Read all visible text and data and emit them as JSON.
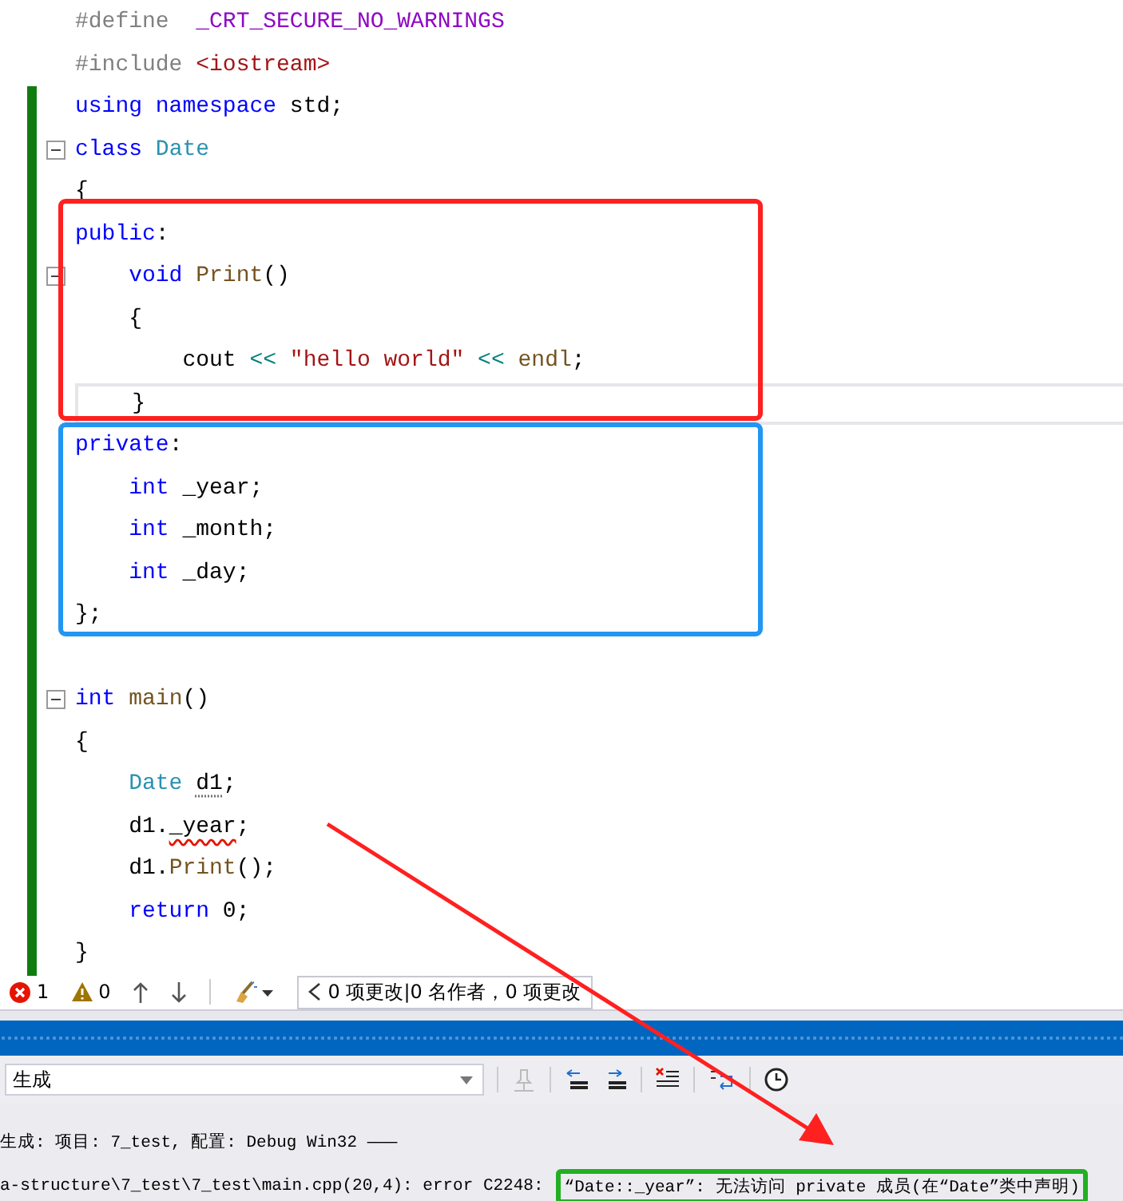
{
  "editor": {
    "lines": [
      {
        "changed": false,
        "current": false,
        "foldable": false,
        "tokens": [
          {
            "kind": "preproc",
            "text": "#define  "
          },
          {
            "kind": "macro",
            "text": "_CRT_SECURE_NO_WARNINGS"
          }
        ]
      },
      {
        "changed": false,
        "current": false,
        "foldable": false,
        "tokens": [
          {
            "kind": "preproc",
            "text": "#include "
          },
          {
            "kind": "string",
            "text": "<iostream>"
          }
        ]
      },
      {
        "changed": true,
        "current": false,
        "foldable": false,
        "tokens": [
          {
            "kind": "keyword",
            "text": "using namespace"
          },
          {
            "kind": "plain",
            "text": " std;"
          }
        ]
      },
      {
        "changed": true,
        "current": false,
        "foldable": true,
        "tokens": [
          {
            "kind": "keyword",
            "text": "class"
          },
          {
            "kind": "type",
            "text": " Date"
          }
        ]
      },
      {
        "changed": true,
        "current": false,
        "foldable": false,
        "tokens": [
          {
            "kind": "plain",
            "text": "{"
          }
        ]
      },
      {
        "changed": true,
        "current": false,
        "foldable": false,
        "tokens": [
          {
            "kind": "keyword",
            "text": "public"
          },
          {
            "kind": "plain",
            "text": ":"
          }
        ]
      },
      {
        "changed": true,
        "current": false,
        "foldable": true,
        "tokens": [
          {
            "kind": "keyword",
            "text": "    void"
          },
          {
            "kind": "function",
            "text": " Print"
          },
          {
            "kind": "plain",
            "text": "()"
          }
        ]
      },
      {
        "changed": true,
        "current": false,
        "foldable": false,
        "tokens": [
          {
            "kind": "plain",
            "text": "    {"
          }
        ]
      },
      {
        "changed": true,
        "current": false,
        "foldable": false,
        "tokens": [
          {
            "kind": "plain",
            "text": "        cout "
          },
          {
            "kind": "operator",
            "text": "<<"
          },
          {
            "kind": "string",
            "text": " \"hello world\""
          },
          {
            "kind": "operator",
            "text": " <<"
          },
          {
            "kind": "function",
            "text": " endl"
          },
          {
            "kind": "plain",
            "text": ";"
          }
        ]
      },
      {
        "changed": true,
        "current": true,
        "foldable": false,
        "tokens": [
          {
            "kind": "plain",
            "text": "    }"
          }
        ]
      },
      {
        "changed": true,
        "current": false,
        "foldable": false,
        "tokens": [
          {
            "kind": "keyword",
            "text": "private"
          },
          {
            "kind": "plain",
            "text": ":"
          }
        ]
      },
      {
        "changed": true,
        "current": false,
        "foldable": false,
        "tokens": [
          {
            "kind": "keyword",
            "text": "    int"
          },
          {
            "kind": "plain",
            "text": " _year;"
          }
        ]
      },
      {
        "changed": true,
        "current": false,
        "foldable": false,
        "tokens": [
          {
            "kind": "keyword",
            "text": "    int"
          },
          {
            "kind": "plain",
            "text": " _month;"
          }
        ]
      },
      {
        "changed": true,
        "current": false,
        "foldable": false,
        "tokens": [
          {
            "kind": "keyword",
            "text": "    int"
          },
          {
            "kind": "plain",
            "text": " _day;"
          }
        ]
      },
      {
        "changed": true,
        "current": false,
        "foldable": false,
        "tokens": [
          {
            "kind": "plain",
            "text": "};"
          }
        ]
      },
      {
        "changed": true,
        "current": false,
        "foldable": false
      },
      {
        "changed": true,
        "current": false,
        "foldable": true,
        "tokens": [
          {
            "kind": "keyword",
            "text": "int"
          },
          {
            "kind": "function",
            "text": " main"
          },
          {
            "kind": "plain",
            "text": "()"
          }
        ]
      },
      {
        "changed": true,
        "current": false,
        "foldable": false,
        "tokens": [
          {
            "kind": "plain",
            "text": "{"
          }
        ]
      },
      {
        "changed": true,
        "current": false,
        "foldable": false,
        "tokens": [
          {
            "kind": "type",
            "text": "    Date "
          },
          {
            "kind": "plain",
            "text": "d1",
            "hint": true
          },
          {
            "kind": "plain",
            "text": ";"
          }
        ]
      },
      {
        "changed": true,
        "current": false,
        "foldable": false,
        "tokens": [
          {
            "kind": "plain",
            "text": "    d1."
          },
          {
            "kind": "plain",
            "text": "_year",
            "error": true
          },
          {
            "kind": "plain",
            "text": ";"
          }
        ]
      },
      {
        "changed": true,
        "current": false,
        "foldable": false,
        "tokens": [
          {
            "kind": "plain",
            "text": "    d1."
          },
          {
            "kind": "function",
            "text": "Print"
          },
          {
            "kind": "plain",
            "text": "();"
          }
        ]
      },
      {
        "changed": true,
        "current": false,
        "foldable": false,
        "tokens": [
          {
            "kind": "keyword",
            "text": "    return"
          },
          {
            "kind": "plain",
            "text": " 0;"
          }
        ]
      },
      {
        "changed": true,
        "current": false,
        "foldable": false,
        "tokens": [
          {
            "kind": "plain",
            "text": "}"
          }
        ]
      }
    ]
  },
  "status_bar": {
    "errors": "1",
    "warnings": "0",
    "changes": "0 项更改|0 名作者，0 项更改"
  },
  "output": {
    "source": "生成",
    "lines": [
      {
        "text": "生成: 项目: 7_test, 配置: Debug Win32 ———"
      },
      {
        "text": "a-structure\\7_test\\7_test\\main.cpp(20,4): error C2248:",
        "message": "“Date::_year”: 无法访问 private 成员(在“Date”类中声明)"
      }
    ]
  },
  "annotations": [
    {
      "kind": "box",
      "color": "#ff2020"
    },
    {
      "kind": "box",
      "color": "#2196f3"
    },
    {
      "kind": "arrow",
      "color": "#ff2020"
    },
    {
      "kind": "message_box",
      "color": "#22b022"
    }
  ]
}
